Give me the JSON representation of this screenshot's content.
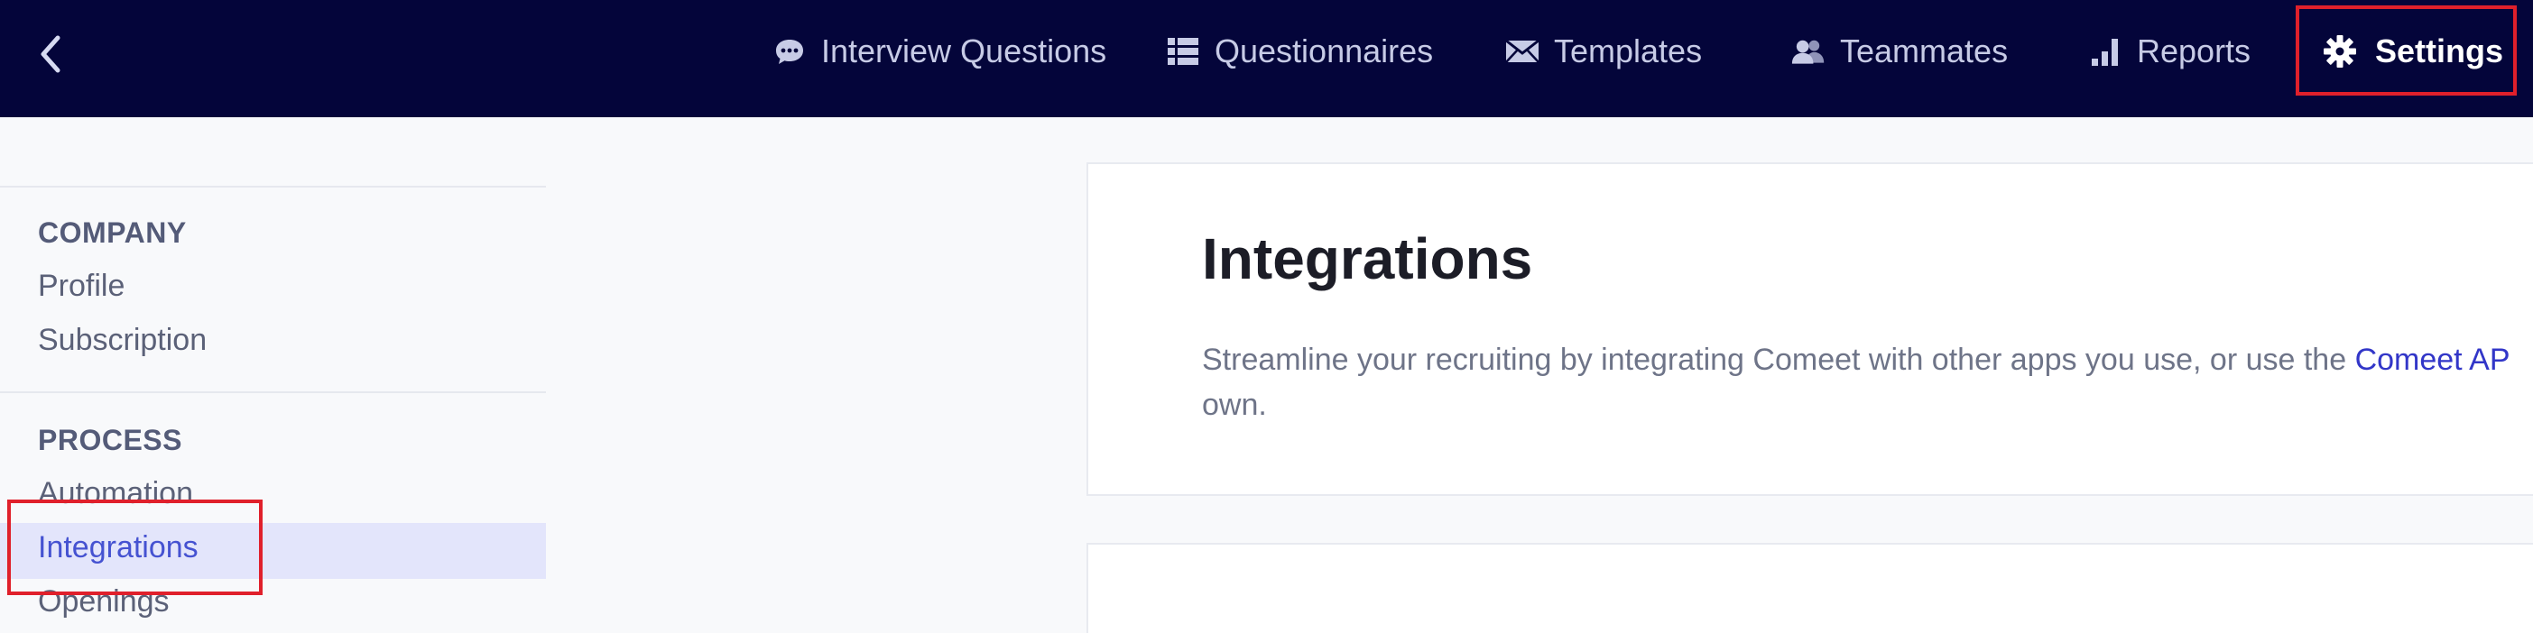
{
  "topbar": {
    "nav": [
      {
        "label": "Interview Questions",
        "icon": "chat-bubble-icon"
      },
      {
        "label": "Questionnaires",
        "icon": "list-icon"
      },
      {
        "label": "Templates",
        "icon": "envelope-icon"
      },
      {
        "label": "Teammates",
        "icon": "users-icon"
      },
      {
        "label": "Reports",
        "icon": "bar-chart-icon"
      },
      {
        "label": "Settings",
        "icon": "gear-icon",
        "active": true
      }
    ]
  },
  "sidebar": {
    "sections": [
      {
        "title": "COMPANY",
        "items": [
          "Profile",
          "Subscription"
        ]
      },
      {
        "title": "PROCESS",
        "items": [
          "Automation",
          "Integrations",
          "Openings"
        ]
      }
    ],
    "active_item": "Integrations"
  },
  "main": {
    "title": "Integrations",
    "description_before": "Streamline your recruiting by integrating Comeet with other apps you use, or use the ",
    "description_link": "Comeet AP",
    "description_after": "own."
  },
  "colors": {
    "topbar": "#04053a",
    "highlight": "#e0202b",
    "active_link": "#4552d1"
  }
}
